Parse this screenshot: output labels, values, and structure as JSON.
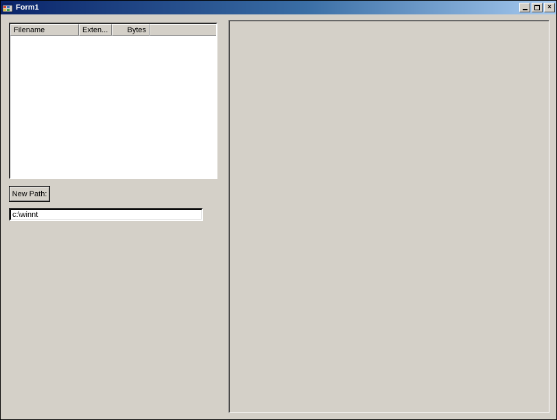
{
  "window": {
    "title": "Form1"
  },
  "listview": {
    "columns": [
      {
        "label": "Filename",
        "align": "left"
      },
      {
        "label": "Exten...",
        "align": "left"
      },
      {
        "label": "Bytes",
        "align": "right"
      }
    ]
  },
  "new_path_button": {
    "label": "New Path:"
  },
  "path_textbox": {
    "value": "c:\\winnt"
  }
}
